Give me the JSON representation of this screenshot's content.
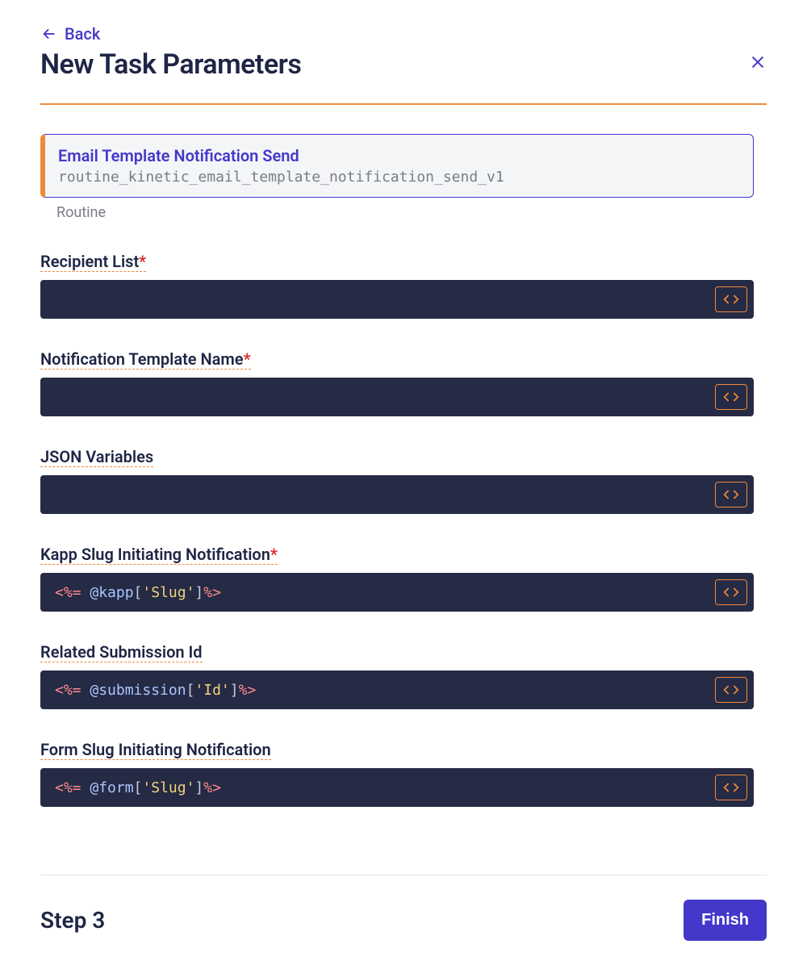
{
  "header": {
    "back_label": "Back",
    "title": "New Task Parameters"
  },
  "routine": {
    "title": "Email Template Notification Send",
    "slug": "routine_kinetic_email_template_notification_send_v1",
    "type_label": "Routine"
  },
  "fields": [
    {
      "label": "Recipient List",
      "required": true,
      "tokens": []
    },
    {
      "label": "Notification Template Name",
      "required": true,
      "tokens": []
    },
    {
      "label": "JSON Variables",
      "required": false,
      "tokens": []
    },
    {
      "label": "Kapp Slug Initiating Notification",
      "required": true,
      "tokens": [
        {
          "cls": "tok-del",
          "t": "<%="
        },
        {
          "cls": "",
          "t": " "
        },
        {
          "cls": "tok-obj",
          "t": "@kapp"
        },
        {
          "cls": "tok-br",
          "t": "["
        },
        {
          "cls": "tok-str",
          "t": "'Slug'"
        },
        {
          "cls": "tok-br",
          "t": "]"
        },
        {
          "cls": "tok-del",
          "t": "%>"
        }
      ]
    },
    {
      "label": "Related Submission Id",
      "required": false,
      "tokens": [
        {
          "cls": "tok-del",
          "t": "<%="
        },
        {
          "cls": "",
          "t": " "
        },
        {
          "cls": "tok-obj",
          "t": "@submission"
        },
        {
          "cls": "tok-br",
          "t": "["
        },
        {
          "cls": "tok-str",
          "t": "'Id'"
        },
        {
          "cls": "tok-br",
          "t": "]"
        },
        {
          "cls": "tok-del",
          "t": "%>"
        }
      ]
    },
    {
      "label": "Form Slug Initiating Notification",
      "required": false,
      "tokens": [
        {
          "cls": "tok-del",
          "t": "<%="
        },
        {
          "cls": "",
          "t": " "
        },
        {
          "cls": "tok-obj",
          "t": "@form"
        },
        {
          "cls": "tok-br",
          "t": "["
        },
        {
          "cls": "tok-str",
          "t": "'Slug'"
        },
        {
          "cls": "tok-br",
          "t": "]"
        },
        {
          "cls": "tok-del",
          "t": "%>"
        }
      ]
    }
  ],
  "footer": {
    "step_label": "Step 3",
    "finish_label": "Finish"
  },
  "required_marker": "*"
}
